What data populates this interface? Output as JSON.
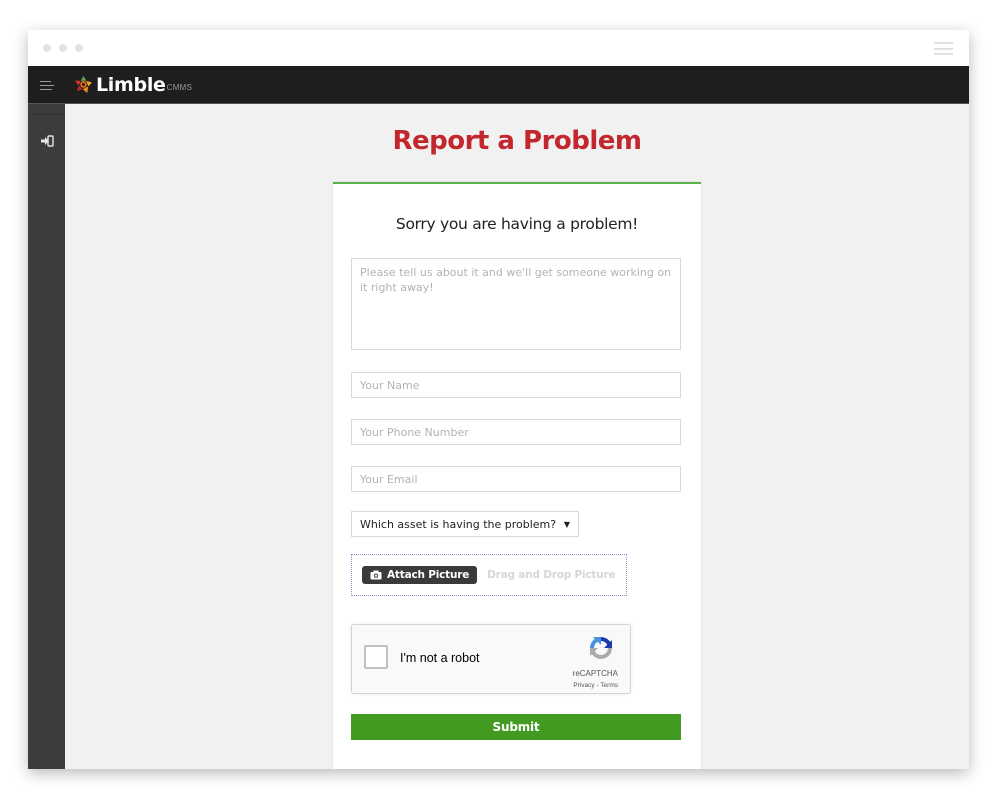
{
  "window": {
    "dots": [
      "window-dot",
      "window-dot",
      "window-dot"
    ],
    "menu_icon": "hamburger-icon"
  },
  "appbar": {
    "menu_icon": "menu-icon",
    "logo_text": "Limble",
    "logo_sub": "CMMS",
    "logo_icon": "limble-logo-icon"
  },
  "sidebar": {
    "items": [
      {
        "icon": "sign-in-icon"
      }
    ]
  },
  "page": {
    "title": "Report a Problem",
    "title_color": "#c1272d",
    "accent_color": "#5bb047"
  },
  "form": {
    "heading": "Sorry you are having a problem!",
    "description": {
      "value": "",
      "placeholder": "Please tell us about it and we'll get someone working on it right away!"
    },
    "name": {
      "value": "",
      "placeholder": "Your Name"
    },
    "phone": {
      "value": "",
      "placeholder": "Your Phone Number"
    },
    "email": {
      "value": "",
      "placeholder": "Your Email"
    },
    "asset_select": {
      "selected": "Which asset is having the problem?",
      "caret": "▼"
    },
    "attach": {
      "button_label": "Attach Picture",
      "drag_label": "Drag and Drop Picture",
      "icon": "camera-icon"
    },
    "recaptcha": {
      "label": "I'm not a robot",
      "brand": "reCAPTCHA",
      "links": "Privacy - Terms",
      "checked": false
    },
    "submit_label": "Submit",
    "submit_color": "#439a21"
  }
}
